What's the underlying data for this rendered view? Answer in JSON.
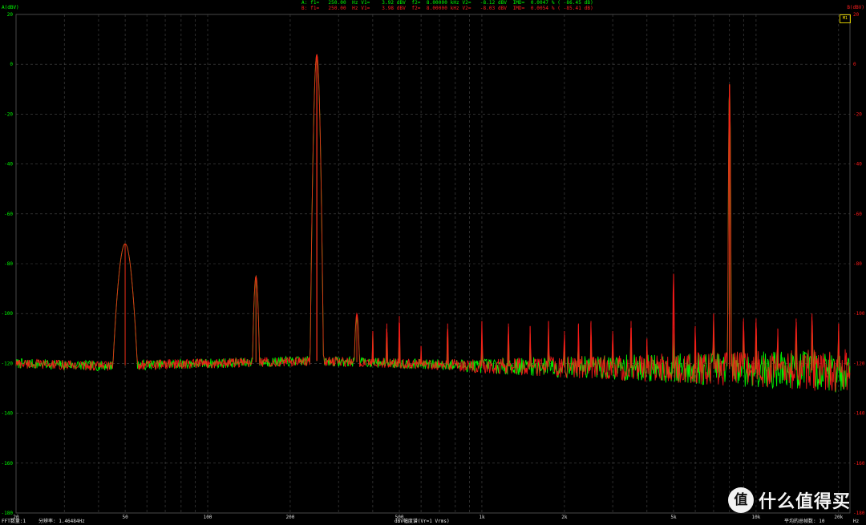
{
  "header": {
    "line_a": "A: f1=   250.00  Hz V1=    3.92 dBV  f2=  8.00000 kHz V2=   -8.12 dBV  IMD=  0.0047 % ( -86.45 dB)",
    "line_b": "B: f1=   250.00  Hz V1=    3.98 dBV  f2=  8.00000 kHz V2=   -8.03 dBV  IMD=  0.0054 % ( -85.41 dB)",
    "left_axis_name": "A(dBV)",
    "right_axis_name": "B(dBV)",
    "badge": "M1"
  },
  "footer": {
    "fft_count": "FFT数量:1",
    "resolution": "分辨率: 1.46484Hz",
    "spectrum_label": "dBV幅度谱(Vr=1 Vrms)",
    "avg_count": "平均的总帧数: 10",
    "unit": "Hz"
  },
  "watermark": {
    "logo": "值",
    "text": "什么值得买"
  },
  "colors": {
    "channel_a": "#00ff00",
    "channel_b": "#ff1a1a",
    "grid": "#4a4a4a",
    "background": "#000000"
  },
  "chart_data": {
    "type": "line",
    "x_scale": "log",
    "xlim": [
      20,
      22000
    ],
    "ylim": [
      -180,
      20
    ],
    "yticks_left": [
      20,
      0,
      -20,
      -40,
      -60,
      -80,
      -100,
      -120,
      -140,
      -160,
      -180
    ],
    "yticks_right": [
      20,
      0,
      -20,
      -40,
      -60,
      -80,
      -100,
      -120,
      -140,
      -160,
      -180
    ],
    "xticks": [
      {
        "value": 20,
        "label": "20"
      },
      {
        "value": 50,
        "label": "50"
      },
      {
        "value": 100,
        "label": "100"
      },
      {
        "value": 200,
        "label": "200"
      },
      {
        "value": 500,
        "label": "500"
      },
      {
        "value": 1000,
        "label": "1k"
      },
      {
        "value": 2000,
        "label": "2k"
      },
      {
        "value": 5000,
        "label": "5k"
      },
      {
        "value": 10000,
        "label": "10k"
      },
      {
        "value": 20000,
        "label": "20k"
      }
    ],
    "grid": true,
    "noise_floor": [
      {
        "x": 20,
        "y": -120
      },
      {
        "x": 40,
        "y": -121
      },
      {
        "x": 100,
        "y": -120
      },
      {
        "x": 250,
        "y": -119
      },
      {
        "x": 1000,
        "y": -121
      },
      {
        "x": 5000,
        "y": -122
      },
      {
        "x": 22000,
        "y": -123
      }
    ],
    "series": [
      {
        "name": "A",
        "peaks": [
          {
            "x": 50,
            "y": -72
          },
          {
            "x": 150,
            "y": -85
          },
          {
            "x": 250,
            "y": 3.92
          },
          {
            "x": 350,
            "y": -101
          },
          {
            "x": 400,
            "y": -108
          },
          {
            "x": 450,
            "y": -106
          },
          {
            "x": 500,
            "y": -107
          },
          {
            "x": 600,
            "y": -115
          },
          {
            "x": 750,
            "y": -106
          },
          {
            "x": 1000,
            "y": -108
          },
          {
            "x": 1250,
            "y": -107
          },
          {
            "x": 1500,
            "y": -108
          },
          {
            "x": 1750,
            "y": -106
          },
          {
            "x": 2000,
            "y": -111
          },
          {
            "x": 2250,
            "y": -113
          },
          {
            "x": 2500,
            "y": -108
          },
          {
            "x": 3000,
            "y": -111
          },
          {
            "x": 3500,
            "y": -107
          },
          {
            "x": 4000,
            "y": -113
          },
          {
            "x": 5000,
            "y": -108
          },
          {
            "x": 6000,
            "y": -110
          },
          {
            "x": 7000,
            "y": -103
          },
          {
            "x": 8000,
            "y": -8.12
          },
          {
            "x": 9000,
            "y": -107
          },
          {
            "x": 10000,
            "y": -105
          },
          {
            "x": 12000,
            "y": -109
          },
          {
            "x": 14000,
            "y": -106
          },
          {
            "x": 16000,
            "y": -103
          },
          {
            "x": 20000,
            "y": -107
          }
        ]
      },
      {
        "name": "B",
        "peaks": [
          {
            "x": 50,
            "y": -72
          },
          {
            "x": 150,
            "y": -85
          },
          {
            "x": 250,
            "y": 3.98
          },
          {
            "x": 350,
            "y": -100
          },
          {
            "x": 400,
            "y": -107
          },
          {
            "x": 450,
            "y": -104
          },
          {
            "x": 500,
            "y": -101
          },
          {
            "x": 600,
            "y": -113
          },
          {
            "x": 750,
            "y": -104
          },
          {
            "x": 1000,
            "y": -103
          },
          {
            "x": 1250,
            "y": -104
          },
          {
            "x": 1500,
            "y": -105
          },
          {
            "x": 1750,
            "y": -103
          },
          {
            "x": 2000,
            "y": -107
          },
          {
            "x": 2250,
            "y": -104
          },
          {
            "x": 2500,
            "y": -103
          },
          {
            "x": 3000,
            "y": -107
          },
          {
            "x": 3500,
            "y": -103
          },
          {
            "x": 4000,
            "y": -110
          },
          {
            "x": 5000,
            "y": -84
          },
          {
            "x": 6000,
            "y": -105
          },
          {
            "x": 7000,
            "y": -100
          },
          {
            "x": 8000,
            "y": -8.03
          },
          {
            "x": 9000,
            "y": -102
          },
          {
            "x": 10000,
            "y": -102
          },
          {
            "x": 12000,
            "y": -106
          },
          {
            "x": 14000,
            "y": -102
          },
          {
            "x": 16000,
            "y": -100
          },
          {
            "x": 20000,
            "y": -104
          }
        ]
      }
    ]
  }
}
